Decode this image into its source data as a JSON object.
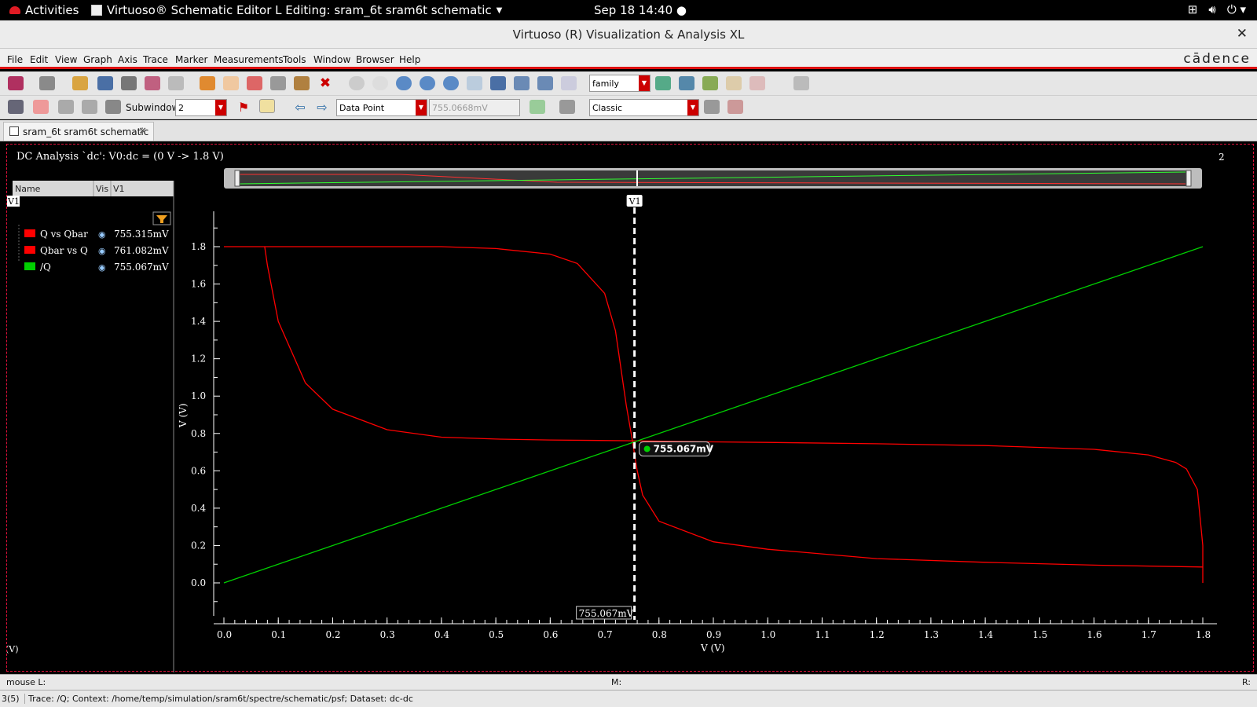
{
  "topbar": {
    "activities": "Activities",
    "app_title": "Virtuoso® Schematic Editor L Editing: sram_6t sram6t schematic",
    "clock": "Sep 18  14:40"
  },
  "window": {
    "title": "Virtuoso (R) Visualization & Analysis XL",
    "brand": "cādence"
  },
  "menu": [
    "File",
    "Edit",
    "View",
    "Graph",
    "Axis",
    "Trace",
    "Marker",
    "Measurements",
    "Tools",
    "Window",
    "Browser",
    "Help"
  ],
  "toolbar": {
    "family_value": "family",
    "subwindow_label": "Subwindow:",
    "subwindow_value": "2",
    "marker_mode": "Data Point",
    "marker_value": "755.0668mV",
    "style_value": "Classic"
  },
  "tab": {
    "label": "sram_6t sram6t schematic"
  },
  "graph": {
    "title": "DC Analysis `dc': V0:dc = (0 V -> 1.8 V)",
    "subwindow_number": "2",
    "legend_headers": [
      "Name",
      "Vis",
      "V1"
    ],
    "legend_marker_tag": "V1",
    "legend_rows": [
      {
        "name": "Q vs Qbar",
        "value": "755.315mV",
        "color": "#ff0000"
      },
      {
        "name": "Qbar vs Q",
        "value": "761.082mV",
        "color": "#ff0000"
      },
      {
        "name": "/Q",
        "value": "755.067mV",
        "color": "#00d000"
      }
    ],
    "y_unit_corner": "(V)",
    "marker": {
      "name": "V1",
      "x_readout": "755.067mV",
      "point_label": "755.067mV"
    }
  },
  "chart_data": {
    "type": "line",
    "xlabel": "V (V)",
    "ylabel": "V (V)",
    "xlim": [
      0.0,
      1.8
    ],
    "ylim": [
      -0.1,
      1.95
    ],
    "xticks": [
      "0.0",
      "0.1",
      "0.2",
      "0.3",
      "0.4",
      "0.5",
      "0.6",
      "0.7",
      "0.8",
      "0.9",
      "1.0",
      "1.1",
      "1.2",
      "1.3",
      "1.4",
      "1.5",
      "1.6",
      "1.7",
      "1.8"
    ],
    "yticks": [
      "0.0",
      "0.2",
      "0.4",
      "0.6",
      "0.8",
      "1.0",
      "1.2",
      "1.4",
      "1.6",
      "1.8"
    ],
    "grid": false,
    "marker_x": 0.755,
    "series": [
      {
        "name": "Q vs Qbar",
        "color": "#ff0000",
        "x": [
          0.0,
          0.1,
          0.2,
          0.3,
          0.4,
          0.5,
          0.6,
          0.65,
          0.7,
          0.72,
          0.74,
          0.75,
          0.76,
          0.77,
          0.8,
          0.9,
          1.0,
          1.2,
          1.4,
          1.6,
          1.8
        ],
        "y": [
          1.8,
          1.8,
          1.8,
          1.8,
          1.8,
          1.79,
          1.76,
          1.71,
          1.55,
          1.35,
          0.95,
          0.78,
          0.6,
          0.47,
          0.33,
          0.22,
          0.18,
          0.13,
          0.11,
          0.095,
          0.085
        ]
      },
      {
        "name": "Qbar vs Q",
        "color": "#ff0000",
        "x": [
          0.075,
          0.08,
          0.1,
          0.15,
          0.2,
          0.3,
          0.4,
          0.5,
          0.6,
          0.755,
          0.9,
          1.0,
          1.2,
          1.4,
          1.6,
          1.7,
          1.75,
          1.77,
          1.79,
          1.8,
          1.8
        ],
        "y": [
          1.8,
          1.7,
          1.4,
          1.07,
          0.93,
          0.82,
          0.78,
          0.77,
          0.765,
          0.761,
          0.755,
          0.752,
          0.745,
          0.735,
          0.715,
          0.685,
          0.645,
          0.61,
          0.5,
          0.2,
          0.0
        ]
      },
      {
        "name": "/Q",
        "color": "#00d000",
        "x": [
          0.0,
          1.8
        ],
        "y": [
          0.0,
          1.8
        ]
      }
    ]
  }
}
